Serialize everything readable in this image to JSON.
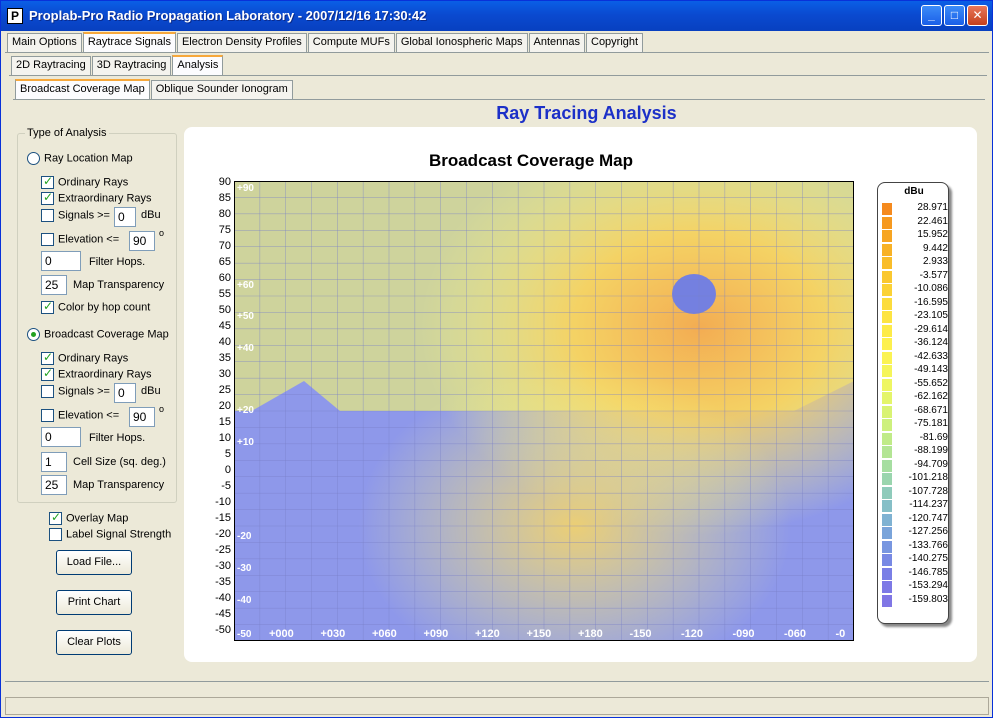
{
  "window": {
    "title": "Proplab-Pro Radio Propagation Laboratory - 2007/12/16 17:30:42",
    "app_icon_char": "P"
  },
  "tabs_main": [
    {
      "label": "Main Options",
      "active": false
    },
    {
      "label": "Raytrace Signals",
      "active": true
    },
    {
      "label": "Electron Density Profiles",
      "active": false
    },
    {
      "label": "Compute MUFs",
      "active": false
    },
    {
      "label": "Global Ionospheric Maps",
      "active": false
    },
    {
      "label": "Antennas",
      "active": false
    },
    {
      "label": "Copyright",
      "active": false
    }
  ],
  "tabs_sub": [
    {
      "label": "2D Raytracing",
      "active": false
    },
    {
      "label": "3D Raytracing",
      "active": false
    },
    {
      "label": "Analysis",
      "active": true
    }
  ],
  "tabs_sub2": [
    {
      "label": "Broadcast Coverage Map",
      "active": true
    },
    {
      "label": "Oblique Sounder Ionogram",
      "active": false
    }
  ],
  "options": {
    "group_title": "Type of Analysis",
    "ray_location_map": "Ray Location Map",
    "ordinary_rays": "Ordinary Rays",
    "extraordinary_rays": "Extraordinary Rays",
    "signals_gte": "Signals >=",
    "signals_value": "0",
    "dbu": "dBu",
    "elevation_lte": "Elevation <=",
    "elevation_value": "90",
    "degree": "o",
    "filter_hops_value": "0",
    "filter_hops": "Filter Hops.",
    "map_transparency_value": "25",
    "map_transparency": "Map Transparency",
    "color_by_hop": "Color by hop count",
    "broadcast_coverage_map": "Broadcast Coverage Map",
    "cell_size_value": "1",
    "cell_size": "Cell Size (sq. deg.)",
    "overlay_map": "Overlay Map",
    "label_signal_strength": "Label Signal Strength"
  },
  "buttons": {
    "load": "Load File...",
    "print": "Print Chart",
    "clear": "Clear Plots"
  },
  "header": {
    "analysis_title": "Ray Tracing Analysis"
  },
  "chart_data": {
    "type": "heatmap",
    "title": "Broadcast Coverage Map",
    "y_ticks": [
      "90",
      "85",
      "80",
      "75",
      "70",
      "65",
      "60",
      "55",
      "50",
      "45",
      "40",
      "35",
      "30",
      "25",
      "20",
      "15",
      "10",
      "5",
      "0",
      "-5",
      "-10",
      "-15",
      "-20",
      "-25",
      "-30",
      "-35",
      "-40",
      "-45",
      "-50"
    ],
    "x_ticks": [
      "+000",
      "+030",
      "+060",
      "+090",
      "+120",
      "+150",
      "+180",
      "-150",
      "-120",
      "-090",
      "-060",
      "-0"
    ],
    "inner_lat_labels": [
      "+90",
      "+60",
      "+50",
      "+40",
      "+20",
      "+10",
      "-20",
      "-30",
      "-40",
      "-50"
    ],
    "legend": {
      "title": "dBu",
      "entries": [
        {
          "label": "28.971",
          "color": "#f58a1e"
        },
        {
          "label": "22.461",
          "color": "#f6991f"
        },
        {
          "label": "15.952",
          "color": "#f7a522"
        },
        {
          "label": "9.442",
          "color": "#f8b226"
        },
        {
          "label": "2.933",
          "color": "#f9bd2a"
        },
        {
          "label": "-3.577",
          "color": "#fac830"
        },
        {
          "label": "-10.086",
          "color": "#fbd236"
        },
        {
          "label": "-16.595",
          "color": "#fcdc3c"
        },
        {
          "label": "-23.105",
          "color": "#fde442"
        },
        {
          "label": "-29.614",
          "color": "#fdeb48"
        },
        {
          "label": "-36.124",
          "color": "#fdf04e"
        },
        {
          "label": "-42.633",
          "color": "#fbf353"
        },
        {
          "label": "-49.143",
          "color": "#f5f55a"
        },
        {
          "label": "-55.652",
          "color": "#eef662"
        },
        {
          "label": "-62.162",
          "color": "#e4f56a"
        },
        {
          "label": "-68.671",
          "color": "#d9f373"
        },
        {
          "label": "-75.181",
          "color": "#cdf07d"
        },
        {
          "label": "-81.69",
          "color": "#c0eb88"
        },
        {
          "label": "-88.199",
          "color": "#b3e594"
        },
        {
          "label": "-94.709",
          "color": "#a6dea1"
        },
        {
          "label": "-101.218",
          "color": "#9ad5ae"
        },
        {
          "label": "-107.728",
          "color": "#8fcbbb"
        },
        {
          "label": "-114.237",
          "color": "#86bfc7"
        },
        {
          "label": "-120.747",
          "color": "#7fb2d2"
        },
        {
          "label": "-127.256",
          "color": "#7aa4da"
        },
        {
          "label": "-133.766",
          "color": "#7896e0"
        },
        {
          "label": "-140.275",
          "color": "#7889e4"
        },
        {
          "label": "-146.785",
          "color": "#7a7fe6"
        },
        {
          "label": "-153.294",
          "color": "#7d79e6"
        },
        {
          "label": "-159.803",
          "color": "#8076e5"
        }
      ]
    }
  }
}
